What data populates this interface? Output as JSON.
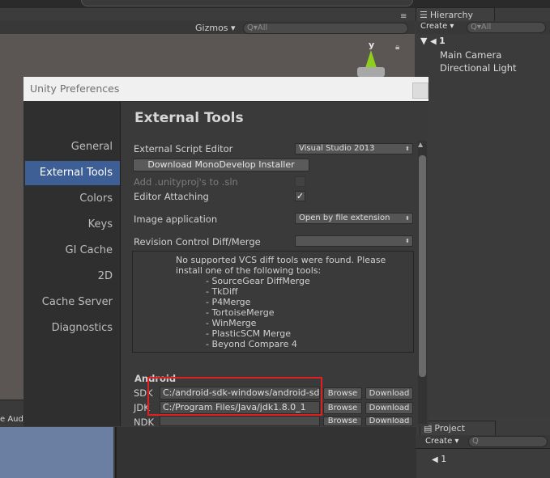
{
  "editor": {
    "gizmos": "Gizmos ▾",
    "scene_search": "Q▾All",
    "axis_label": "y",
    "audio_label": "e Audi"
  },
  "hierarchy": {
    "tab": "Hierarchy",
    "create": "Create ▾",
    "search": "Q▾All",
    "scene_name": "1",
    "items": [
      "Main Camera",
      "Directional Light"
    ]
  },
  "project": {
    "tab": "Project",
    "create": "Create ▾",
    "search": "Q",
    "items": [
      "1"
    ]
  },
  "preferences": {
    "window_title": "Unity Preferences",
    "sidebar": [
      "General",
      "External Tools",
      "Colors",
      "Keys",
      "GI Cache",
      "2D",
      "Cache Server",
      "Diagnostics"
    ],
    "active_item": "External Tools",
    "heading": "External Tools",
    "script_editor_label": "External Script Editor",
    "script_editor_value": "Visual Studio 2013",
    "download_button": "Download MonoDevelop Installer",
    "add_unityproj_label": "Add .unityproj's to .sln",
    "add_unityproj_checked": false,
    "editor_attaching_label": "Editor Attaching",
    "editor_attaching_checked": true,
    "image_app_label": "Image application",
    "image_app_value": "Open by file extension",
    "revision_label": "Revision Control Diff/Merge",
    "revision_value": "",
    "vcs_lines": [
      "No supported VCS diff tools were found. Please",
      "install one of the following tools:",
      "        - SourceGear DiffMerge",
      "        - TkDiff",
      "        - P4Merge",
      "        - TortoiseMerge",
      "        - WinMerge",
      "        - PlasticSCM Merge",
      "        - Beyond Compare 4"
    ],
    "android_heading": "Android",
    "sdk": {
      "label": "SDK",
      "path": "C:/android-sdk-windows/android-sdk",
      "browse": "Browse",
      "download": "Download"
    },
    "jdk": {
      "label": "JDK",
      "path": "C:/Program Files/Java/jdk1.8.0_1",
      "browse": "Browse",
      "download": "Download"
    },
    "ndk": {
      "label": "NDK",
      "path": "",
      "browse": "Browse",
      "download": "Download"
    }
  },
  "colors": {
    "active_item_bg": "#3d5f96",
    "highlight_border": "#e02020",
    "gizmo_y": "#8ecf1e",
    "game_view": "#6a7fa1"
  }
}
